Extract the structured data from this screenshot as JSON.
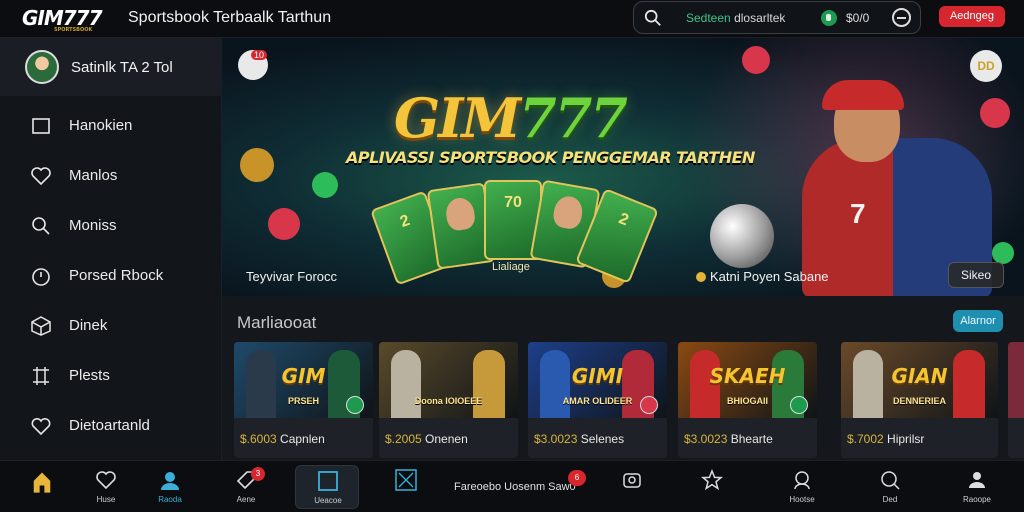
{
  "header": {
    "logo": "GIM777",
    "logo_tag": "SPORTSBOOK",
    "title": "Sportsbook Terbaalk Tarthun",
    "search": {
      "text_accent": "Sedteen",
      "text": "dlosarltek",
      "balance": "$0/0"
    },
    "login_label": "Aedngeg"
  },
  "sidebar": {
    "profile_name": "Satinlk TA 2 Tol",
    "items": [
      {
        "label": "Hanokien",
        "icon": "square-icon"
      },
      {
        "label": "Manlos",
        "icon": "heart-icon"
      },
      {
        "label": "Moniss",
        "icon": "search-icon"
      },
      {
        "label": "Porsed Rbock",
        "icon": "timer-icon"
      },
      {
        "label": "Dinek",
        "icon": "cube-icon"
      },
      {
        "label": "Plests",
        "icon": "grid-icon"
      },
      {
        "label": "Dietoartanld",
        "icon": "heart-outline-icon"
      }
    ]
  },
  "hero": {
    "logo_a": "GIM",
    "logo_b": "777",
    "subtitle": "APLIVASSI SPORTSBOOK PENGGEMAR TARTHEN",
    "card_center": "70",
    "ball_label": "Lialiage",
    "left_caption": "Teyvivar Forocc",
    "right_caption": "Katni Poyen Sabane",
    "button": "Sikeo",
    "badge_left": "10",
    "badge_right": "DD",
    "player_number": "7"
  },
  "games": {
    "title": "Marliaooat",
    "more_label": "Alarnor",
    "cards": [
      {
        "title": "GIM",
        "sub": "PRSEH",
        "price": "$.6003",
        "name": "Capnlen",
        "bg": "#1f4a6a",
        "c1": "#2a3a4a",
        "c2": "#1d5a3a"
      },
      {
        "title": "",
        "sub": "Doona IOIOEEE",
        "price": "$.2005",
        "name": "Onenen",
        "bg": "#5a4a2a",
        "c1": "#b9b2a0",
        "c2": "#c69a3a"
      },
      {
        "title": "GIMI",
        "sub": "AMAR OLIDEER",
        "price": "$3.0023",
        "name": "Selenes",
        "bg": "#1e3f8a",
        "c1": "#2a5ab0",
        "c2": "#b02a3a"
      },
      {
        "title": "SKAEH",
        "sub": "BHIOGAII",
        "price": "$3.0023",
        "name": "Bhearte",
        "bg": "#8a4a12",
        "c1": "#c62a2a",
        "c2": "#2a7a3a"
      },
      {
        "title": "GIAN",
        "sub": "DENNERIEA",
        "price": "$.7002",
        "name": "Hiprilsr",
        "bg": "#6a4a2a",
        "c1": "#b9b2a0",
        "c2": "#c62a2a"
      }
    ]
  },
  "bottom_nav": {
    "items": [
      {
        "label": "",
        "icon": "home-icon"
      },
      {
        "label": "Huse",
        "icon": "heart-icon"
      },
      {
        "label": "Raoda",
        "icon": "user-icon"
      },
      {
        "label": "Aene",
        "icon": "tag-icon",
        "badge": "3"
      },
      {
        "label": "Ueacoe",
        "icon": "square-icon"
      },
      {
        "label": "",
        "icon": "expand-icon"
      },
      {
        "label": "",
        "icon": "camera-icon"
      },
      {
        "label": "",
        "icon": "star-icon"
      },
      {
        "label": "Hootse",
        "icon": "chat-icon"
      },
      {
        "label": "Ded",
        "icon": "search-icon"
      },
      {
        "label": "Raoope",
        "icon": "person-icon"
      }
    ],
    "center_text": "Fareoebo Uosenm Saw0",
    "center_badge": "6"
  }
}
